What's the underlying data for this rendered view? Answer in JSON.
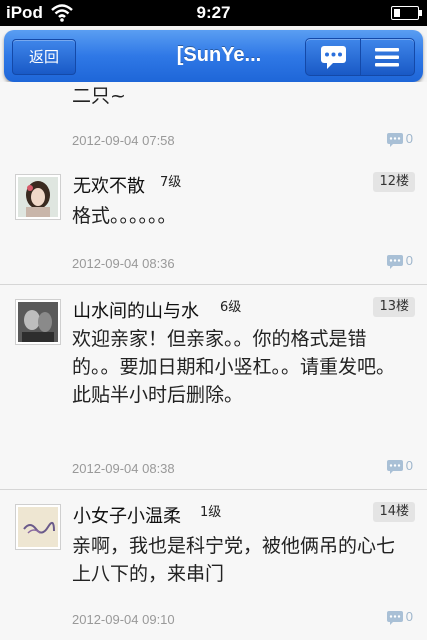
{
  "statusbar": {
    "carrier": "iPod",
    "time": "9:27"
  },
  "navbar": {
    "back_label": "返回",
    "title": "[SunYe..."
  },
  "posts": [
    {
      "partial_text": "二只~",
      "date": "2012-09-04 07:58",
      "comments": "0"
    },
    {
      "username": "无欢不散",
      "level": "7级",
      "floor": "12楼",
      "body": "格式。。。。。。",
      "date": "2012-09-04 08:36",
      "comments": "0"
    },
    {
      "username": "山水间的山与水",
      "level": "6级",
      "floor": "13楼",
      "body": "欢迎亲家！但亲家。。你的格式是错的。。要加日期和小竖杠。。请重发吧。此贴半小时后删除。",
      "date": "2012-09-04 08:38",
      "comments": "0"
    },
    {
      "username": "小女子小温柔",
      "level": "1级",
      "floor": "14楼",
      "body": "亲啊，我也是科宁党，被他俩吊的心七上八下的，来串门",
      "date": "2012-09-04 09:10",
      "comments": "0"
    }
  ]
}
